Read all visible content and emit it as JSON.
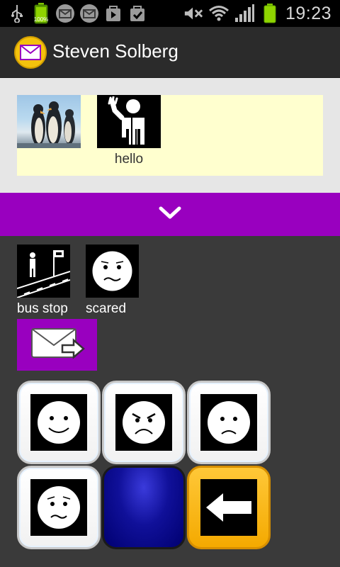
{
  "status_bar": {
    "time": "19:23",
    "battery_text": "100%"
  },
  "action_bar": {
    "title": "Steven Solberg"
  },
  "sentence_strip": {
    "items": [
      {
        "icon": "penguins-photo",
        "label": ""
      },
      {
        "icon": "waving-person-icon",
        "label": "hello"
      }
    ]
  },
  "symbols": {
    "items": [
      {
        "icon": "bus-stop-icon",
        "label": "bus stop"
      },
      {
        "icon": "scared-face-icon",
        "label": "scared"
      }
    ]
  },
  "grid": {
    "tiles": [
      {
        "icon": "happy-face-icon",
        "style": "white"
      },
      {
        "icon": "angry-face-icon",
        "style": "white"
      },
      {
        "icon": "sad-face-icon",
        "style": "white"
      },
      {
        "icon": "worried-face-icon",
        "style": "white"
      },
      {
        "icon": "",
        "style": "blue"
      },
      {
        "icon": "back-arrow-icon",
        "style": "orange"
      }
    ]
  },
  "colors": {
    "accent": "#9900bf",
    "strip_bg": "#ffffcf",
    "orange": "#f4a900",
    "blue": "#000080"
  }
}
